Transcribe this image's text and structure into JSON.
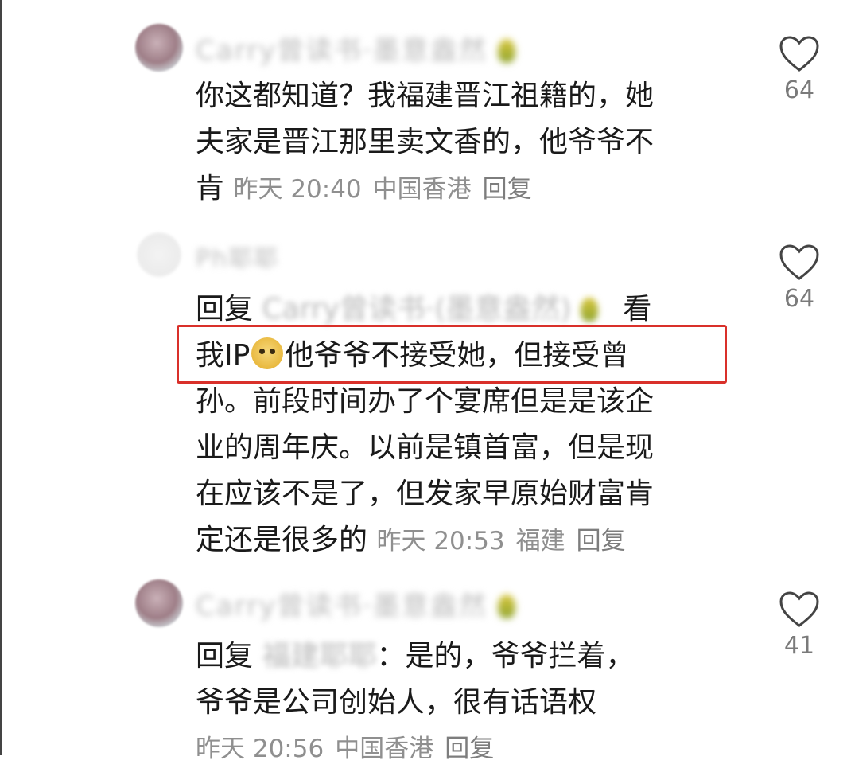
{
  "comments": [
    {
      "username": "Carry曾读书·墨意盎然",
      "text_lines": [
        "你这都知道？我福建晋江祖籍的，她",
        "夫家是晋江那里卖文香的，他爷爷不",
        "肯"
      ],
      "time": "昨天 20:40",
      "location": "中国香港",
      "reply_label": "回复",
      "likes": "64"
    },
    {
      "username": "Ph耶耶",
      "reply_prefix": "回复",
      "reply_to": "Carry曾读书·(墨意盎然)",
      "text_lines": [
        "看",
        "我IP",
        "他爷爷不接受她，但接受曾",
        "孙。前段时间办了个宴席但是是该企",
        "业的周年庆。以前是镇首富，但是现",
        "在应该不是了，但发家早原始财富肯",
        "定还是很多的"
      ],
      "time": "昨天 20:53",
      "location": "福建",
      "reply_label": "回复",
      "likes": "64"
    },
    {
      "username": "Carry曾读书·墨意盎然",
      "reply_prefix": "回复",
      "reply_to": "福建耶耶",
      "text_lines": [
        "：是的，爷爷拦着，",
        "爷爷是公司创始人，很有话语权"
      ],
      "time": "昨天 20:56",
      "location": "中国香港",
      "reply_label": "回复",
      "likes": "41"
    }
  ],
  "icons": {
    "like": "heart-outline-icon",
    "sticker": "ip-sticker-icon"
  },
  "colors": {
    "highlight": "#d9302a",
    "meta": "#8f8f8f"
  }
}
